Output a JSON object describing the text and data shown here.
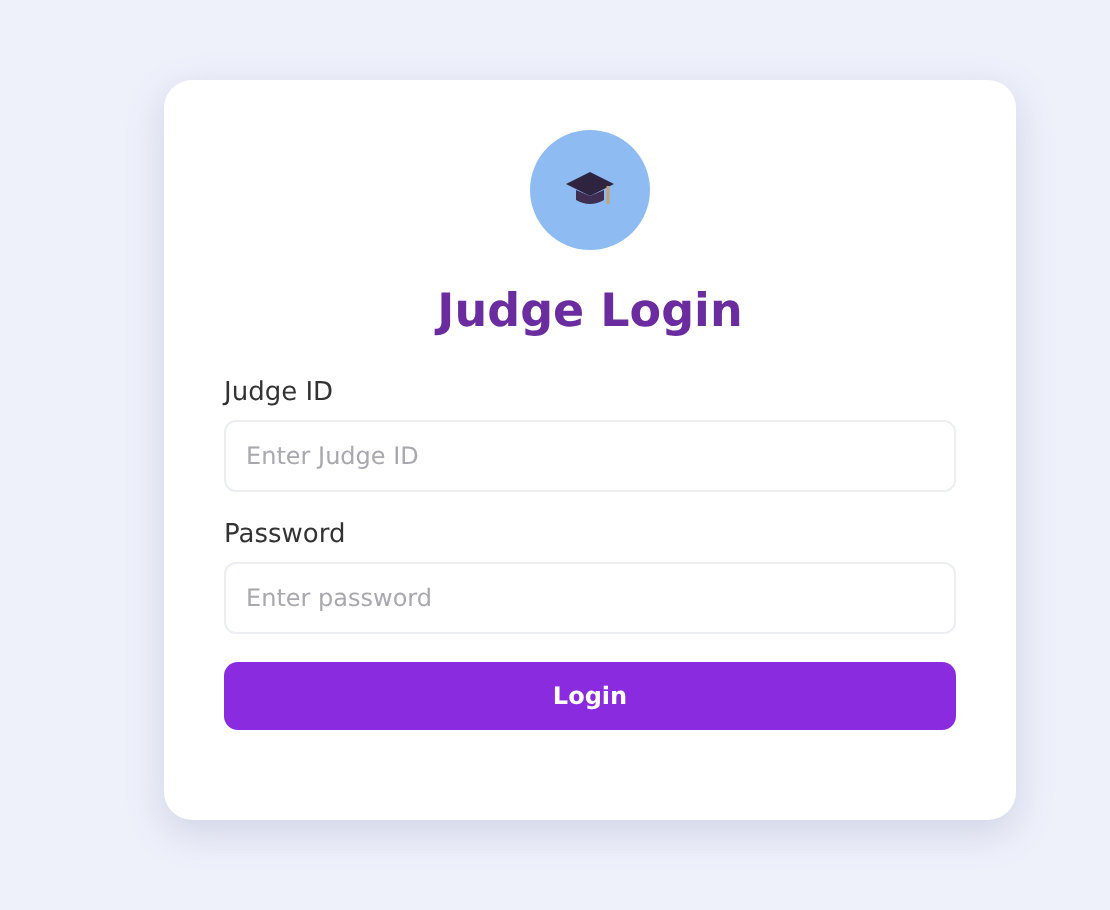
{
  "title": "Judge Login",
  "fields": [
    {
      "label": "Judge ID",
      "placeholder": "Enter Judge ID"
    },
    {
      "label": "Password",
      "placeholder": "Enter password"
    }
  ],
  "button": "Login"
}
